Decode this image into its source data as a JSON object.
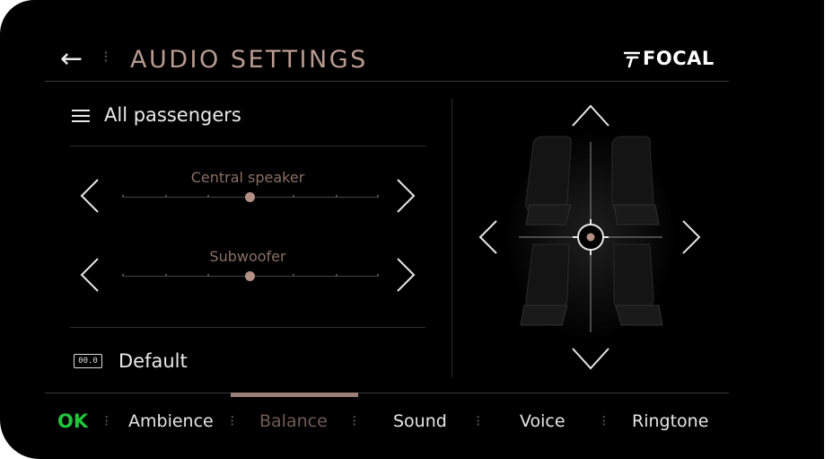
{
  "header": {
    "back_glyph": "←",
    "separator": "⁝",
    "title": "AUDIO SETTINGS",
    "brand": "FOCAL"
  },
  "left_panel": {
    "passengers_label": "All passengers",
    "sliders": [
      {
        "label": "Central speaker",
        "value_fraction": 0.5
      },
      {
        "label": "Subwoofer",
        "value_fraction": 0.5
      }
    ],
    "default_icon_text": "00.0",
    "default_label": "Default"
  },
  "balance_panel": {
    "arrows": [
      "up",
      "down",
      "left",
      "right"
    ]
  },
  "tabs": {
    "ok_label": "OK",
    "separator": "⁝",
    "items": [
      {
        "label": "Ambience",
        "active": false
      },
      {
        "label": "Balance",
        "active": true
      },
      {
        "label": "Sound",
        "active": false
      },
      {
        "label": "Voice",
        "active": false
      },
      {
        "label": "Ringtone",
        "active": false
      }
    ]
  },
  "colors": {
    "accent": "#b89a8f",
    "ok_green": "#21c53c",
    "background": "#000000"
  }
}
